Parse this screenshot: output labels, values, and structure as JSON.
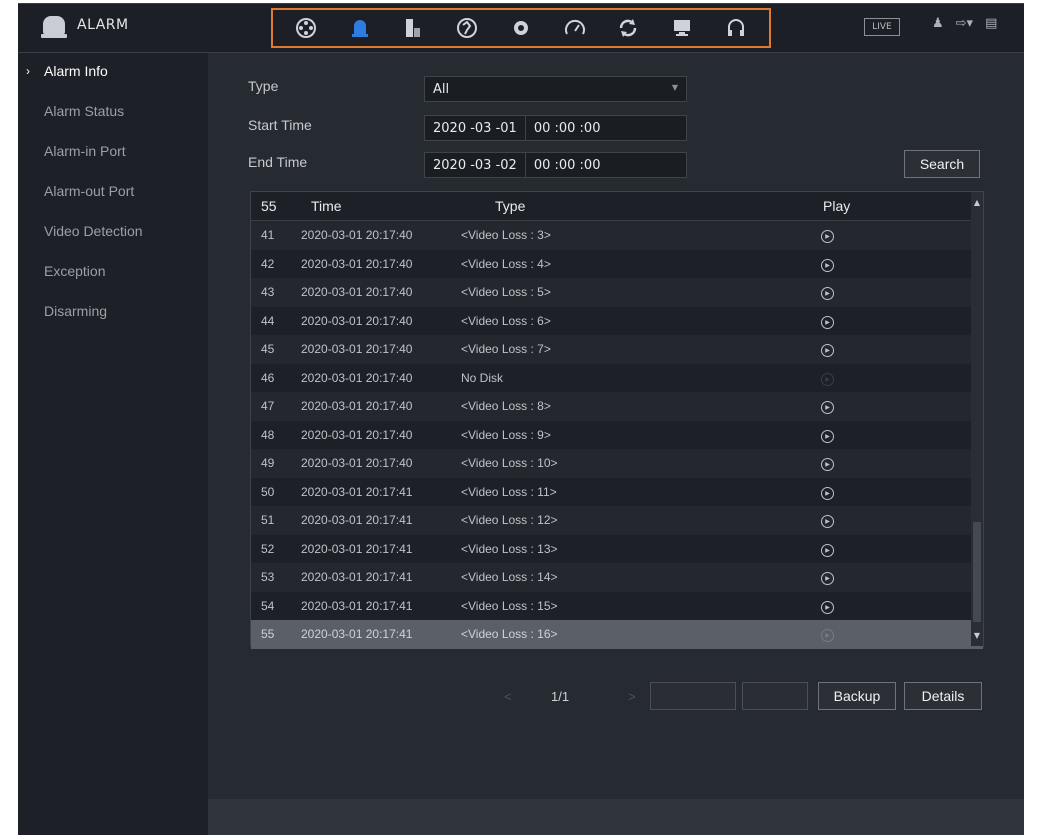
{
  "app": {
    "title": "ALARM"
  },
  "nav_icons": [
    "camera-reel-icon",
    "alarm-light-icon",
    "storage-icon",
    "network-icon",
    "gear-icon",
    "gauge-icon",
    "refresh-icon",
    "monitor-icon",
    "headset-icon"
  ],
  "top_right": {
    "live_label": "LIVE",
    "user_icon": "user-icon",
    "logout_icon": "logout-icon",
    "menu_icon": "menu-icon"
  },
  "sidebar": {
    "items": [
      {
        "label": "Alarm Info",
        "active": true
      },
      {
        "label": "Alarm Status"
      },
      {
        "label": "Alarm-in Port"
      },
      {
        "label": "Alarm-out Port"
      },
      {
        "label": "Video Detection"
      },
      {
        "label": "Exception"
      },
      {
        "label": "Disarming"
      }
    ]
  },
  "filters": {
    "type_label": "Type",
    "type_value": "All",
    "start_label": "Start Time",
    "start_date": "2020 -03 -01",
    "start_time": "00 :00 :00",
    "end_label": "End Time",
    "end_date": "2020 -03 -02",
    "end_time": "00 :00 :00",
    "search_label": "Search"
  },
  "table": {
    "headers": {
      "count": "55",
      "time": "Time",
      "type": "Type",
      "play": "Play"
    },
    "rows": [
      {
        "no": "41",
        "time": "2020-03-01 20:17:40",
        "type": "<Video Loss : 3>",
        "playable": true
      },
      {
        "no": "42",
        "time": "2020-03-01 20:17:40",
        "type": "<Video Loss : 4>",
        "playable": true
      },
      {
        "no": "43",
        "time": "2020-03-01 20:17:40",
        "type": "<Video Loss : 5>",
        "playable": true
      },
      {
        "no": "44",
        "time": "2020-03-01 20:17:40",
        "type": "<Video Loss : 6>",
        "playable": true
      },
      {
        "no": "45",
        "time": "2020-03-01 20:17:40",
        "type": "<Video Loss : 7>",
        "playable": true
      },
      {
        "no": "46",
        "time": "2020-03-01 20:17:40",
        "type": "No Disk",
        "playable": false
      },
      {
        "no": "47",
        "time": "2020-03-01 20:17:40",
        "type": "<Video Loss : 8>",
        "playable": true
      },
      {
        "no": "48",
        "time": "2020-03-01 20:17:40",
        "type": "<Video Loss : 9>",
        "playable": true
      },
      {
        "no": "49",
        "time": "2020-03-01 20:17:40",
        "type": "<Video Loss : 10>",
        "playable": true
      },
      {
        "no": "50",
        "time": "2020-03-01 20:17:41",
        "type": "<Video Loss : 11>",
        "playable": true
      },
      {
        "no": "51",
        "time": "2020-03-01 20:17:41",
        "type": "<Video Loss : 12>",
        "playable": true
      },
      {
        "no": "52",
        "time": "2020-03-01 20:17:41",
        "type": "<Video Loss : 13>",
        "playable": true
      },
      {
        "no": "53",
        "time": "2020-03-01 20:17:41",
        "type": "<Video Loss : 14>",
        "playable": true
      },
      {
        "no": "54",
        "time": "2020-03-01 20:17:41",
        "type": "<Video Loss : 15>",
        "playable": true
      },
      {
        "no": "55",
        "time": "2020-03-01 20:17:41",
        "type": "<Video Loss : 16>",
        "playable": true,
        "selected": true
      }
    ]
  },
  "pager": {
    "page": "1/1",
    "prev": "<",
    "next": ">"
  },
  "actions": {
    "backup_label": "Backup",
    "details_label": "Details"
  }
}
